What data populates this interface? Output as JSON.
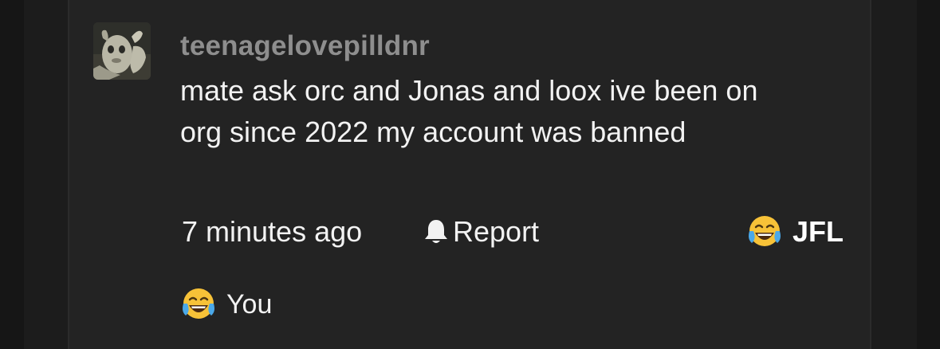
{
  "comment": {
    "username": "teenagelovepilldnr",
    "body_lines": [
      "mate ask orc and Jonas and loox ive been on",
      "org since 2022 my account was banned"
    ],
    "timestamp": "7 minutes ago",
    "report_label": "Report",
    "reaction": {
      "emoji": "face-with-tears-of-joy",
      "label": "JFL"
    },
    "reactors": [
      {
        "emoji": "face-with-tears-of-joy",
        "name": "You"
      }
    ]
  },
  "icons": {
    "report": "bell-icon",
    "reaction": "face-with-tears-of-joy-icon"
  },
  "colors": {
    "page_background": "#161616",
    "card_background": "#232323",
    "username": "#8e8e8e",
    "text": "#f2f2f2",
    "emoji_yellow": "#f7c238",
    "emoji_tears": "#4aa8e8"
  }
}
